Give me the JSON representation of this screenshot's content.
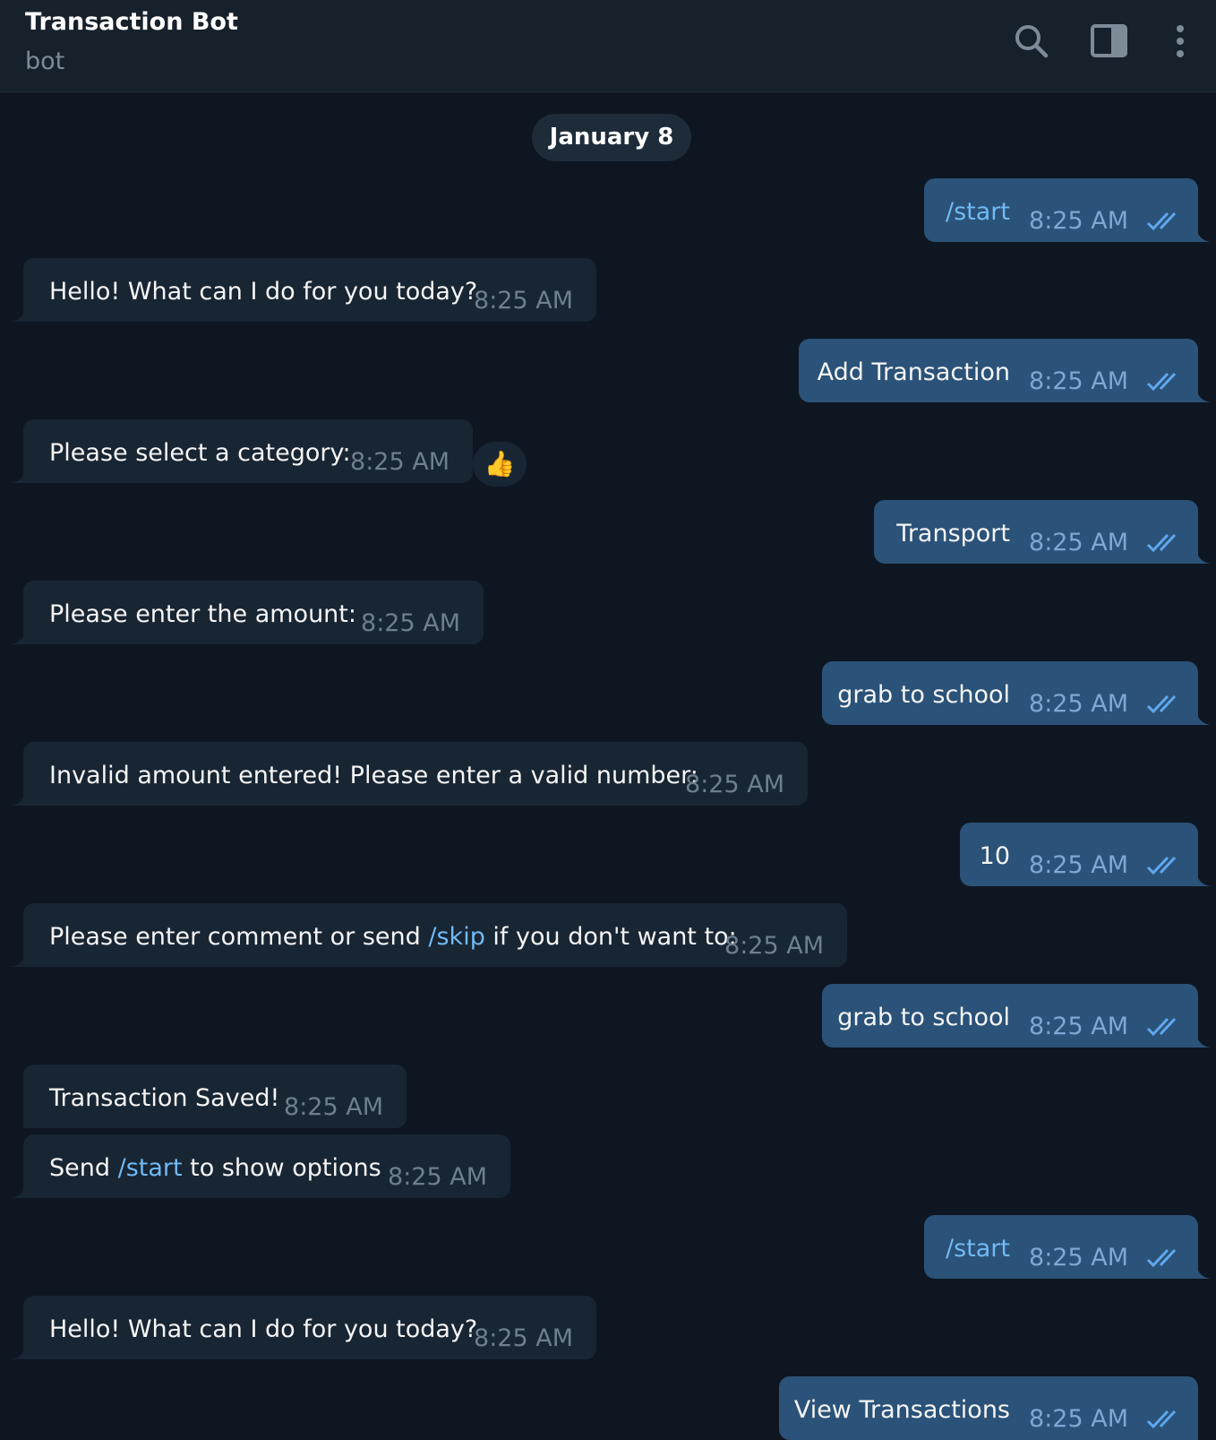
{
  "header": {
    "title": "Transaction Bot",
    "subtitle": "bot",
    "icons": [
      "search-icon",
      "sidebar-toggle-icon",
      "more-vertical-icon"
    ]
  },
  "date_divider": "January 8",
  "colors": {
    "background": "#0e1621",
    "header": "#17212b",
    "incoming_bubble": "#182533",
    "outgoing_bubble": "#2b5278",
    "command_link": "#71baf5"
  },
  "messages": [
    {
      "dir": "out",
      "text": "/start",
      "time": "8:25 AM"
    },
    {
      "dir": "in",
      "text": "Hello! What can I do for you today?",
      "time": "8:25 AM"
    },
    {
      "dir": "out",
      "text": "Add Transaction",
      "time": "8:25 AM"
    },
    {
      "dir": "in",
      "text": "Please select a category:",
      "time": "8:25 AM",
      "reaction": "👍"
    },
    {
      "dir": "out",
      "text": "Transport",
      "time": "8:25 AM"
    },
    {
      "dir": "in",
      "text": "Please enter the amount:",
      "time": "8:25 AM"
    },
    {
      "dir": "out",
      "text": "grab to school",
      "time": "8:25 AM"
    },
    {
      "dir": "in",
      "text": "Invalid amount entered! Please enter a valid number:",
      "time": "8:25 AM"
    },
    {
      "dir": "out",
      "text": "10",
      "time": "8:25 AM"
    },
    {
      "dir": "in",
      "text_before": "Please enter comment or send ",
      "command": "/skip",
      "text_after": " if you don't want to:",
      "time": "8:25 AM"
    },
    {
      "dir": "out",
      "text": "grab to school",
      "time": "8:25 AM"
    },
    {
      "dir": "in",
      "text": "Transaction Saved!",
      "time": "8:25 AM"
    },
    {
      "dir": "in",
      "text_before": "Send ",
      "command": "/start",
      "text_after": " to show options",
      "time": "8:25 AM"
    },
    {
      "dir": "out",
      "text": "/start",
      "time": "8:25 AM"
    },
    {
      "dir": "in",
      "text": "Hello! What can I do for you today?",
      "time": "8:25 AM"
    },
    {
      "dir": "out",
      "text": "View Transactions",
      "time": "8:25 AM"
    }
  ]
}
